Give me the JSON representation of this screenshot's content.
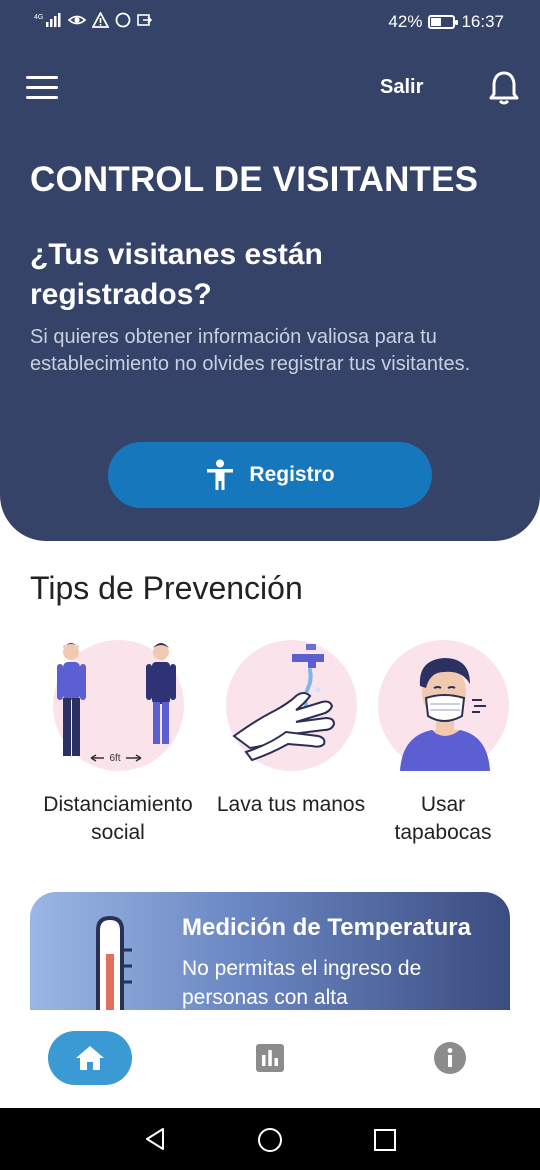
{
  "status_bar": {
    "network_label": "4G",
    "battery_percent": "42%",
    "battery_level": 0.42,
    "time": "16:37",
    "icons": [
      "signal-icon",
      "eye-icon",
      "warning-icon",
      "circle-icon",
      "sync-icon"
    ]
  },
  "app_bar": {
    "menu_icon": "hamburger-menu-icon",
    "logout_label": "Salir",
    "notification_icon": "bell-icon"
  },
  "hero": {
    "title": "CONTROL DE VISITANTES",
    "question": "¿Tus visitanes están registrados?",
    "description": "Si quieres obtener información valiosa para tu establecimiento no olvides registrar tus visitantes.",
    "button_label": "Registro",
    "button_icon": "person-icon"
  },
  "tips": {
    "title": "Tips de Prevención",
    "items": [
      {
        "label": "Distanciamiento social",
        "illustration": "social-distancing-illustration",
        "caption": "6ft"
      },
      {
        "label": "Lava tus manos",
        "illustration": "hand-washing-illustration"
      },
      {
        "label": "Usar tapabocas",
        "illustration": "face-mask-illustration"
      }
    ]
  },
  "temperature_card": {
    "title": "Medición de Temperatura",
    "description": "No permitas el ingreso de personas con alta",
    "illustration": "thermometer-illustration"
  },
  "bottom_nav": {
    "items": [
      {
        "icon": "home-icon",
        "active": true
      },
      {
        "icon": "bar-chart-icon",
        "active": false
      },
      {
        "icon": "info-icon",
        "active": false
      }
    ]
  },
  "colors": {
    "header_bg": "#354369",
    "button_blue": "#1777bd",
    "nav_active": "#3b9ad3",
    "tip_circle": "#fbe3ec",
    "inactive_icon": "#8c8c8c"
  }
}
